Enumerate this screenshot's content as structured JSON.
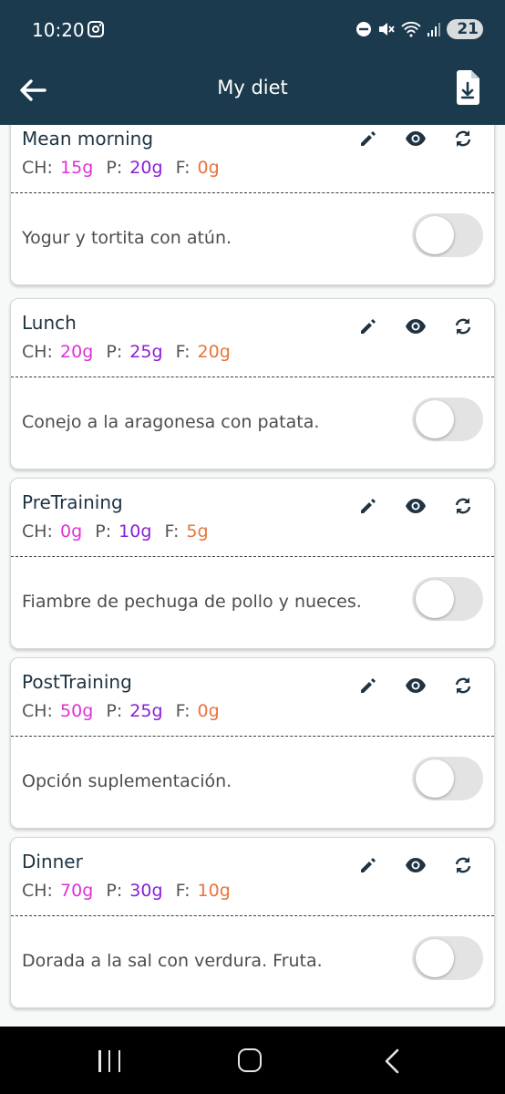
{
  "status_bar": {
    "time": "10:20",
    "battery": "21",
    "icons": [
      "instagram-icon",
      "dnd-icon",
      "mute-icon",
      "wifi-icon",
      "signal-icon",
      "battery-icon"
    ]
  },
  "app_bar": {
    "title": "My diet",
    "back_icon": "arrow-left-icon",
    "download_icon": "file-download-icon"
  },
  "colors": {
    "primary": "#1c3a4d",
    "carbs": "#e030d8",
    "protein": "#8a1fd4",
    "fat": "#e8743b"
  },
  "meals": [
    {
      "title": "Mean morning",
      "ch_label": "CH:",
      "ch": "15g",
      "p_label": "P:",
      "p": "20g",
      "f_label": "F:",
      "f": "0g",
      "description": "Yogur y tortita con atún.",
      "enabled": false
    },
    {
      "title": "Lunch",
      "ch_label": "CH:",
      "ch": "20g",
      "p_label": "P:",
      "p": "25g",
      "f_label": "F:",
      "f": "20g",
      "description": "Conejo a la aragonesa con patata.",
      "enabled": false
    },
    {
      "title": "PreTraining",
      "ch_label": "CH:",
      "ch": "0g",
      "p_label": "P:",
      "p": "10g",
      "f_label": "F:",
      "f": "5g",
      "description": "Fiambre de pechuga de pollo y nueces.",
      "enabled": false
    },
    {
      "title": "PostTraining",
      "ch_label": "CH:",
      "ch": "50g",
      "p_label": "P:",
      "p": "25g",
      "f_label": "F:",
      "f": "0g",
      "description": "Opción suplementación.",
      "enabled": false
    },
    {
      "title": "Dinner",
      "ch_label": "CH:",
      "ch": "70g",
      "p_label": "P:",
      "p": "30g",
      "f_label": "F:",
      "f": "10g",
      "description": "Dorada a la sal con verdura. Fruta.",
      "enabled": false
    }
  ],
  "nav_bar": {
    "icons": [
      "recents-icon",
      "home-icon",
      "back-icon"
    ]
  }
}
